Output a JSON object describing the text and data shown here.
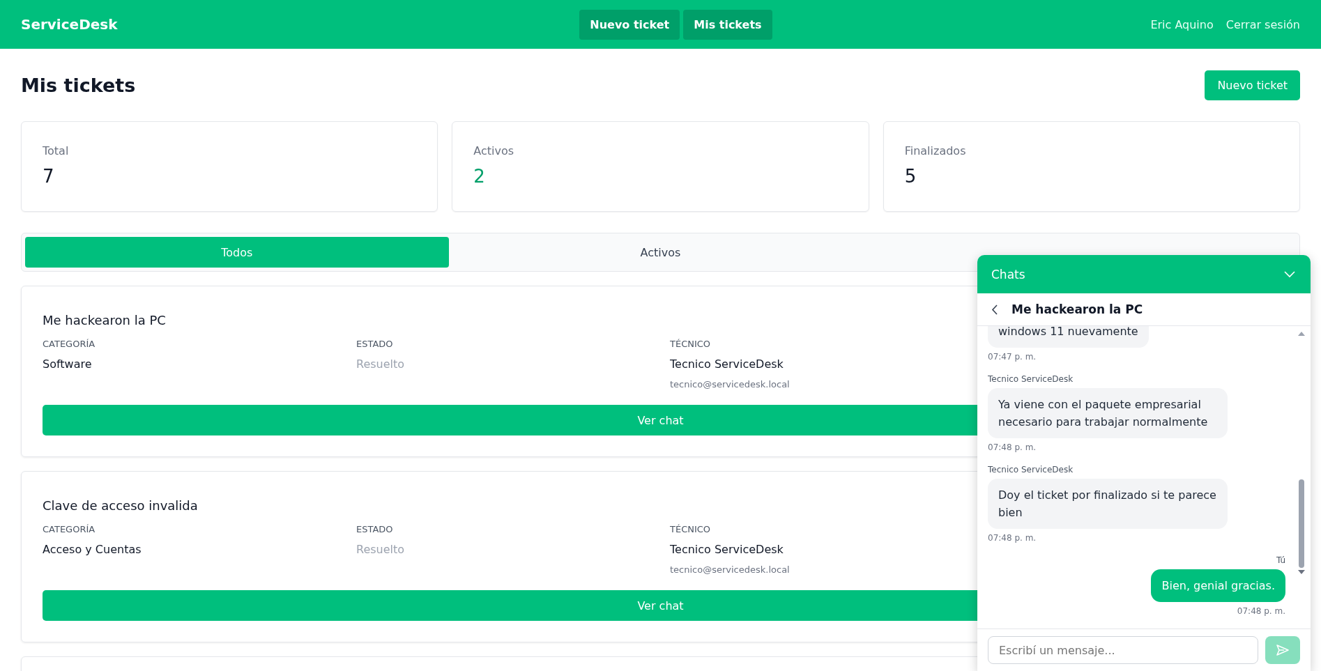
{
  "header": {
    "brand": "ServiceDesk",
    "nav": [
      {
        "label": "Nuevo ticket"
      },
      {
        "label": "Mis tickets"
      }
    ],
    "user": "Eric Aquino",
    "logout": "Cerrar sesión"
  },
  "page": {
    "title": "Mis tickets",
    "new_button": "Nuevo ticket"
  },
  "stats": [
    {
      "label": "Total",
      "value": "7",
      "kind": "total"
    },
    {
      "label": "Activos",
      "value": "2",
      "kind": "active"
    },
    {
      "label": "Finalizados",
      "value": "5",
      "kind": "done"
    }
  ],
  "filter_tabs": [
    {
      "label": "Todos",
      "selected": true
    },
    {
      "label": "Activos",
      "selected": false
    }
  ],
  "tickets": [
    {
      "kind": "full",
      "title": "Me hackearon la PC",
      "category_label": "CATEGORÍA",
      "category": "Software",
      "status_label": "ESTADO",
      "status": "Resuelto",
      "tech_label": "TÉCNICO",
      "tech": "Tecnico ServiceDesk",
      "tech_email": "tecnico@servicedesk.local",
      "button": "Ver chat"
    },
    {
      "kind": "full",
      "title": "Clave de acceso invalida",
      "category_label": "CATEGORÍA",
      "category": "Acceso y Cuentas",
      "status_label": "ESTADO",
      "status": "Resuelto",
      "tech_label": "TÉCNICO",
      "tech": "Tecnico ServiceDesk",
      "tech_email": "tecnico@servicedesk.local",
      "button": "Ver chat"
    },
    {
      "kind": "cut"
    }
  ],
  "chat": {
    "title": "Chats",
    "conversation": "Me hackearon la PC",
    "messages": [
      {
        "kind": "other",
        "text": "windows 11 nuevamente",
        "time": "07:47 p. m."
      },
      {
        "kind": "other",
        "sender": "Tecnico ServiceDesk",
        "text": "Ya viene con el paquete empresarial necesario para trabajar normalmente",
        "time": "07:48 p. m."
      },
      {
        "kind": "other",
        "sender": "Tecnico ServiceDesk",
        "text": "Doy el ticket por finalizado si te parece bien",
        "time": "07:48 p. m."
      },
      {
        "kind": "own",
        "sender": "Tú",
        "text": "Bien, genial gracias.",
        "time": "07:48 p. m."
      }
    ],
    "input": {
      "placeholder": "Escribí un mensaje..."
    },
    "send": {
      "disabled": true
    }
  }
}
